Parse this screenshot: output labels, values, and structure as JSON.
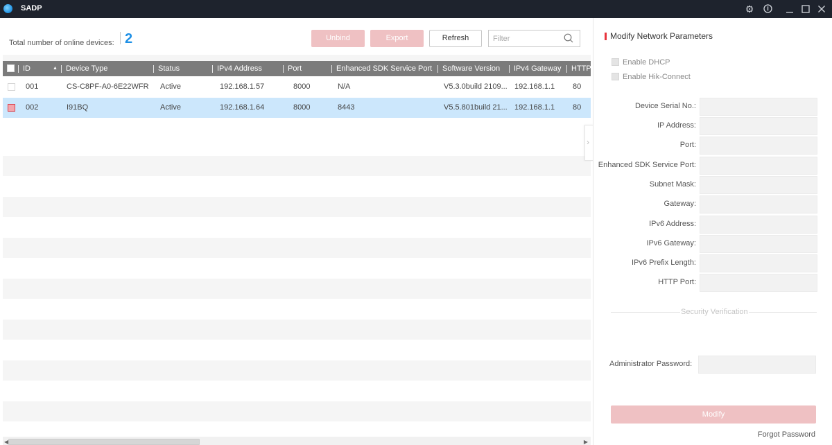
{
  "app": {
    "title": "SADP",
    "icons": [
      "settings-gear-icon",
      "info-icon",
      "minimize-icon",
      "maximize-icon",
      "close-icon"
    ]
  },
  "toolbar": {
    "count_label": "Total number of online devices:",
    "count_value": "2",
    "unbind_label": "Unbind",
    "export_label": "Export",
    "refresh_label": "Refresh",
    "filter_placeholder": "Filter",
    "filter_value": ""
  },
  "table": {
    "columns": [
      "ID",
      "Device Type",
      "Status",
      "IPv4 Address",
      "Port",
      "Enhanced SDK Service Port",
      "Software Version",
      "IPv4 Gateway",
      "HTTP"
    ],
    "sorted_column": "ID",
    "sort_direction": "ascending",
    "rows": [
      {
        "checked": false,
        "selected": false,
        "id": "001",
        "device_type": "CS-C8PF-A0-6E22WFR",
        "status": "Active",
        "ipv4": "192.168.1.57",
        "port": "8000",
        "sdk_port": "N/A",
        "software": "V5.3.0build 2109...",
        "gateway": "192.168.1.1",
        "http": "80"
      },
      {
        "checked": true,
        "selected": true,
        "id": "002",
        "device_type": "I91BQ",
        "status": "Active",
        "ipv4": "192.168.1.64",
        "port": "8000",
        "sdk_port": "8443",
        "software": "V5.5.801build 21...",
        "gateway": "192.168.1.1",
        "http": "80"
      }
    ]
  },
  "panel": {
    "title": "Modify Network Parameters",
    "enable_dhcp": "Enable DHCP",
    "enable_hik": "Enable Hik-Connect",
    "fields": [
      {
        "label": "Device Serial No.:",
        "value": ""
      },
      {
        "label": "IP Address:",
        "value": ""
      },
      {
        "label": "Port:",
        "value": ""
      },
      {
        "label": "Enhanced SDK Service Port:",
        "value": ""
      },
      {
        "label": "Subnet Mask:",
        "value": ""
      },
      {
        "label": "Gateway:",
        "value": ""
      },
      {
        "label": "IPv6 Address:",
        "value": ""
      },
      {
        "label": "IPv6 Gateway:",
        "value": ""
      },
      {
        "label": "IPv6 Prefix Length:",
        "value": ""
      },
      {
        "label": "HTTP Port:",
        "value": ""
      }
    ],
    "security_label": "Security Verification",
    "admin_password_label": "Administrator Password:",
    "modify_label": "Modify",
    "forgot_label": "Forgot Password"
  },
  "colors": {
    "accent_red": "#e8343d",
    "disabled_button": "#efc1c3",
    "selected_row": "#cce7fc",
    "count_blue": "#1e90e6",
    "titlebar": "#1e232d",
    "header_gray": "#7b7b7b"
  }
}
